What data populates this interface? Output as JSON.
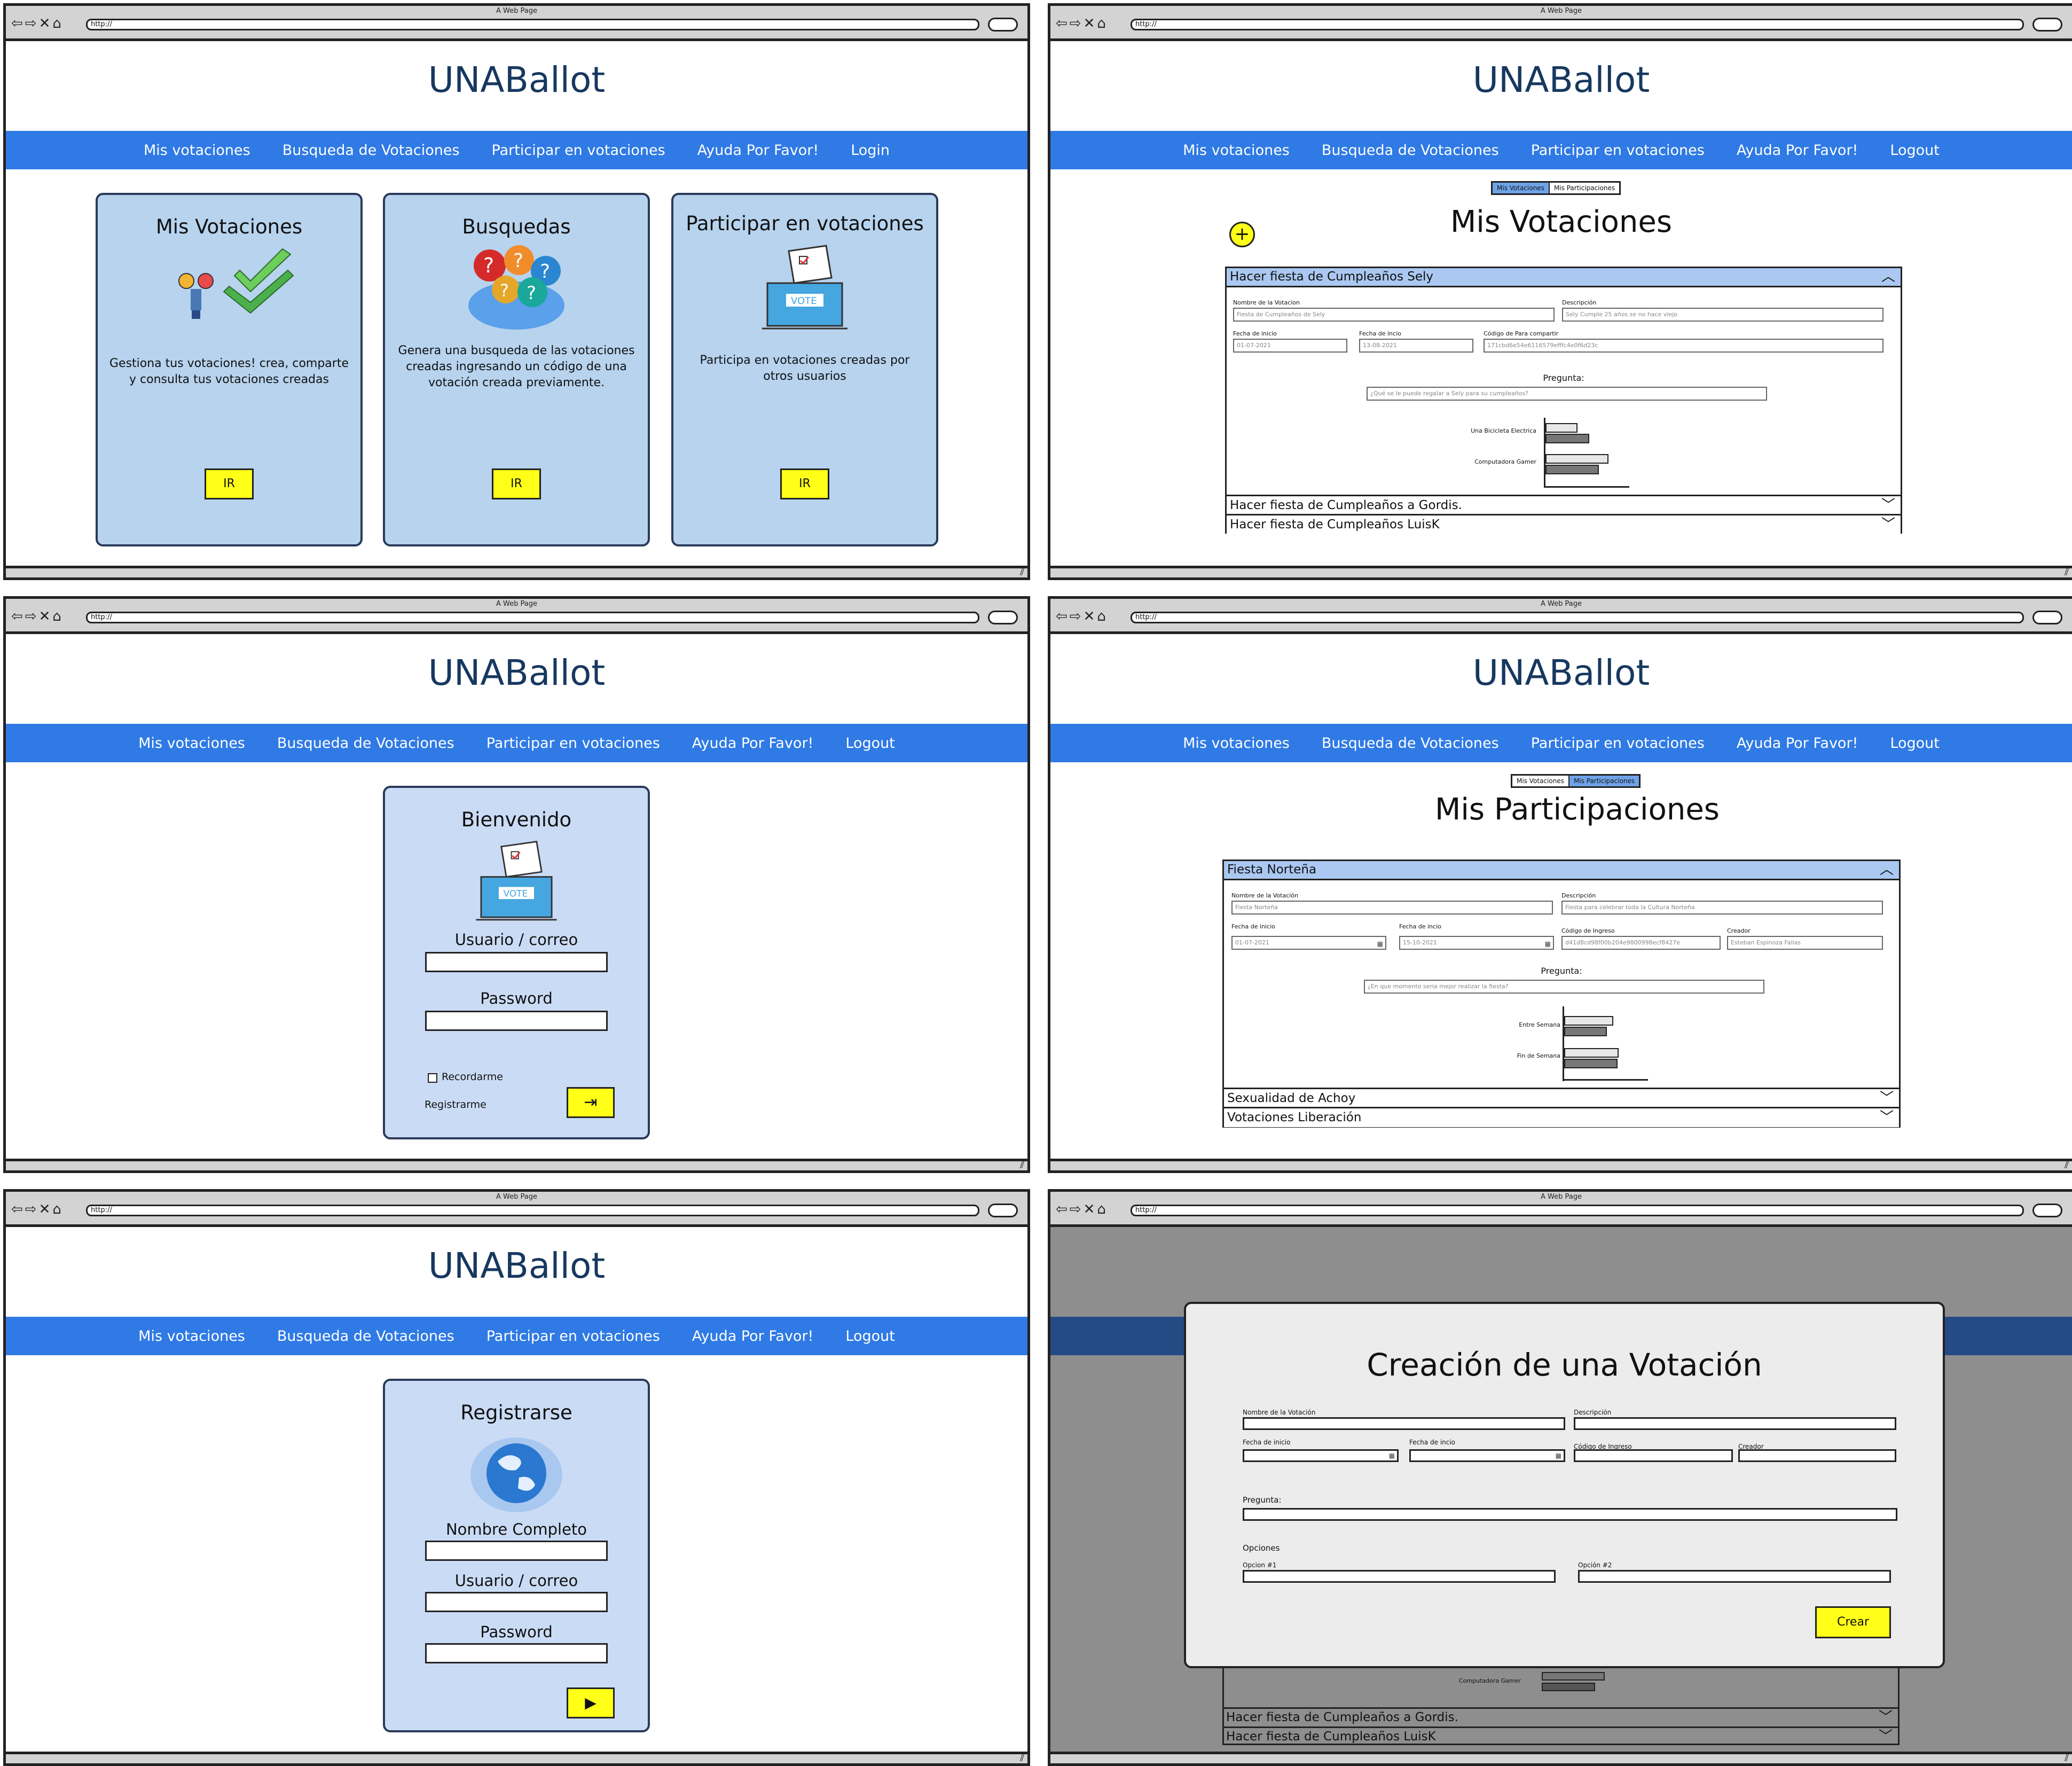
{
  "chrome": {
    "title": "A Web Page",
    "url": "http://"
  },
  "brand": "UNABallot",
  "nav": {
    "mis": "Mis votaciones",
    "busqueda": "Busqueda de Votaciones",
    "participar": "Participar en votaciones",
    "ayuda": "Ayuda Por Favor!",
    "login": "Login",
    "logout": "Logout"
  },
  "home": {
    "card1": {
      "title": "Mis Votaciones",
      "desc": "Gestiona tus votaciones! crea, comparte y consulta tus votaciones creadas",
      "btn": "IR"
    },
    "card2": {
      "title": "Busquedas",
      "desc": "Genera una busqueda de las votaciones creadas ingresando un código de una votación creada previamente.",
      "btn": "IR"
    },
    "card3": {
      "title": "Participar en votaciones",
      "desc": "Participa en votaciones creadas por otros usuarios",
      "btn": "IR"
    }
  },
  "tabs": {
    "mis_votaciones": "Mis Votaciones",
    "mis_participaciones": "Mis Participaciones"
  },
  "misvot": {
    "title": "Mis Votaciones",
    "open": {
      "header": "Hacer fiesta de Cumpleaños Sely",
      "lbl_nombre": "Nombre de la Votacion",
      "val_nombre": "Fiesta de Cumpleaños de Sely",
      "lbl_desc": "Descripción",
      "val_desc": "Sely Cumple 25 años se no hace viejo",
      "lbl_fi": "Fecha de inicio",
      "val_fi": "01-07-2021",
      "lbl_ff": "Fecha de incio",
      "val_ff": "13-08-2021",
      "lbl_cod": "Código de Para compartir",
      "val_cod": "171cbd6e54e6116579efffc4e0f6d23c",
      "lbl_preg": "Pregunta:",
      "val_preg": "¿Qué se le puede regalar a Sely para su cumpleaños?",
      "opt1": "Una Bicicleta Electrica",
      "opt2": "Computadora Gamer"
    },
    "row2": "Hacer fiesta de Cumpleaños a Gordis.",
    "row3": "Hacer fiesta de Cumpleaños LuisK"
  },
  "chart_mis": {
    "type": "bar",
    "categories": [
      "Una Bicicleta Electrica",
      "Computadora Gamer"
    ],
    "series": [
      {
        "values": [
          60,
          80
        ]
      },
      {
        "values": [
          82,
          46
        ]
      }
    ]
  },
  "login": {
    "title": "Bienvenido",
    "user": "Usuario / correo",
    "pass": "Password",
    "remember": "Recordarme",
    "register": "Registrarme"
  },
  "mispart": {
    "title": "Mis Participaciones",
    "open": {
      "header": "Fiesta Norteña",
      "lbl_nombre": "Nombre de la Votación",
      "val_nombre": "Fiesta Norteña",
      "lbl_desc": "Descripción",
      "val_desc": "Fiesta para celebrar toda la Cultura Norteña",
      "lbl_fi": "Fecha de inicio",
      "val_fi": "01-07-2021",
      "lbl_ff": "Fecha de incio",
      "val_ff": "15-10-2021",
      "lbl_cod": "Código de Ingreso",
      "val_cod": "d41d8cd98f00b204e9800998ecf8427e",
      "lbl_creador": "Creador",
      "val_creador": "Esteban Espinoza Fallas",
      "lbl_preg": "Pregunta:",
      "val_preg": "¿En que momento seria mejor realizar la fiesta?",
      "opt1": "Entre Semana",
      "opt2": "Fin de Semana"
    },
    "row2": "Sexualidad de Achoy",
    "row3": "Votaciones Liberación"
  },
  "chart_part": {
    "type": "bar",
    "categories": [
      "Entre Semana",
      "Fin de Semana"
    ],
    "series": [
      {
        "values": [
          70,
          80
        ]
      },
      {
        "values": [
          58,
          72
        ]
      }
    ]
  },
  "register": {
    "title": "Registrarse",
    "name": "Nombre Completo",
    "user": "Usuario / correo",
    "pass": "Password"
  },
  "modal": {
    "title": "Creación de una Votación",
    "lbl_nombre": "Nombre de la Votación",
    "lbl_desc": "Descripción",
    "lbl_fi": "Fecha de inicio",
    "lbl_ff": "Fecha de incio",
    "lbl_cod": "Código de Ingreso",
    "lbl_creador": "Creador",
    "lbl_preg": "Pregunta:",
    "lbl_opciones": "Opciones",
    "lbl_op1": "Opcion #1",
    "lbl_op2": "Opción #2",
    "btn": "Crear",
    "bg_opt": "Computadora Gamer"
  }
}
